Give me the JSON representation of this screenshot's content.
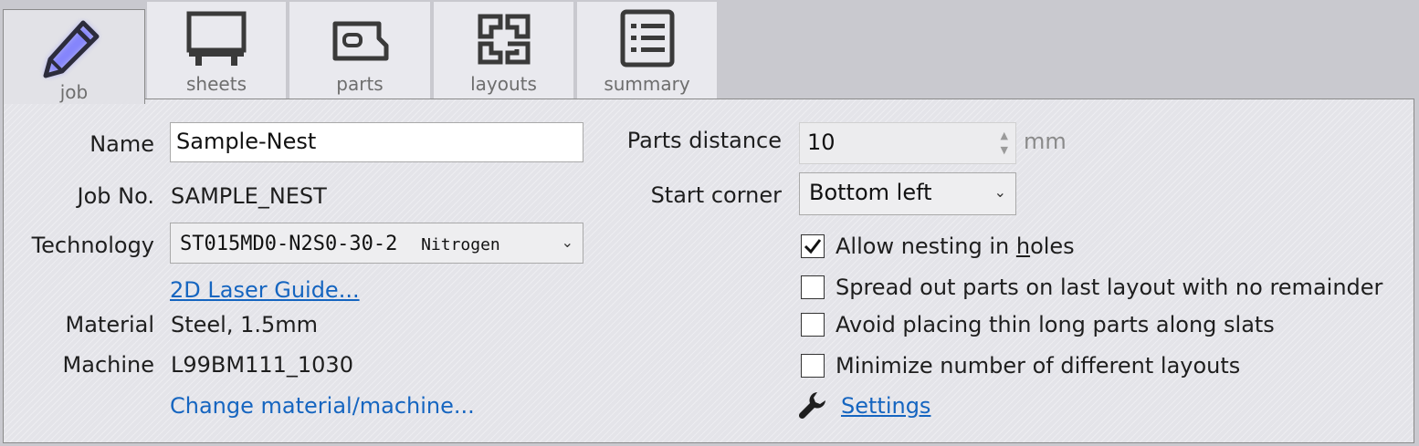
{
  "tabs": [
    {
      "id": "job",
      "label": "job",
      "icon": "pencil-icon",
      "active": true
    },
    {
      "id": "sheets",
      "label": "sheets",
      "icon": "sheet-icon"
    },
    {
      "id": "parts",
      "label": "parts",
      "icon": "part-icon"
    },
    {
      "id": "layouts",
      "label": "layouts",
      "icon": "layouts-icon"
    },
    {
      "id": "summary",
      "label": "summary",
      "icon": "summary-list-icon"
    }
  ],
  "form": {
    "name_label": "Name",
    "name_value": "Sample-Nest",
    "jobno_label": "Job No.",
    "jobno_value": "SAMPLE_NEST",
    "technology_label": "Technology",
    "technology_value": "ST015MD0-N2S0-30-2",
    "technology_gas": "Nitrogen",
    "laser_guide_link": "2D Laser Guide...",
    "material_label": "Material",
    "material_value": "Steel, 1.5mm",
    "machine_label": "Machine",
    "machine_value": "L99BM111_1030",
    "change_link": "Change material/machine...",
    "parts_distance_label": "Parts distance",
    "parts_distance_value": "10",
    "parts_distance_unit": "mm",
    "start_corner_label": "Start corner",
    "start_corner_value": "Bottom left",
    "settings_link": "Settings",
    "settings_icon": "wrench-icon"
  },
  "options": [
    {
      "label_pre": "Allow nesting in ",
      "label_key": "h",
      "label_post": "oles",
      "checked": true
    },
    {
      "label": "Spread out parts on last layout with no remainder",
      "checked": false
    },
    {
      "label": "Avoid placing thin long parts along slats",
      "checked": false
    },
    {
      "label": "Minimize number of different layouts",
      "checked": false
    }
  ],
  "colors": {
    "link": "#1565c0",
    "background": "#c9c9cf",
    "panel": "#e4e4e9",
    "active_icon_glow": "#8f8fff"
  }
}
